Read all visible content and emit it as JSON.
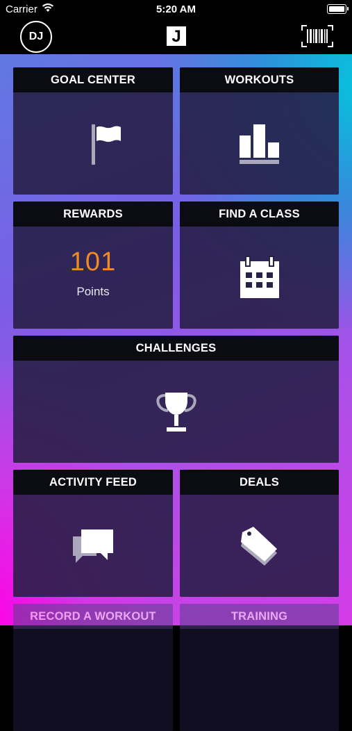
{
  "status_bar": {
    "carrier": "Carrier",
    "time": "5:20 AM"
  },
  "header": {
    "avatar_initials": "DJ",
    "logo_letter": "J"
  },
  "tiles": {
    "goal_center": "GOAL CENTER",
    "workouts": "WORKOUTS",
    "rewards": "REWARDS",
    "find_a_class": "FIND A CLASS",
    "challenges": "CHALLENGES",
    "activity_feed": "ACTIVITY FEED",
    "deals": "DEALS",
    "record_a_workout": "RECORD A WORKOUT",
    "training": "TRAINING"
  },
  "rewards": {
    "points": "101",
    "points_label": "Points"
  },
  "colors": {
    "accent_points": "#f08a24",
    "tile_bg": "#261e44",
    "header_bg": "#000000"
  }
}
